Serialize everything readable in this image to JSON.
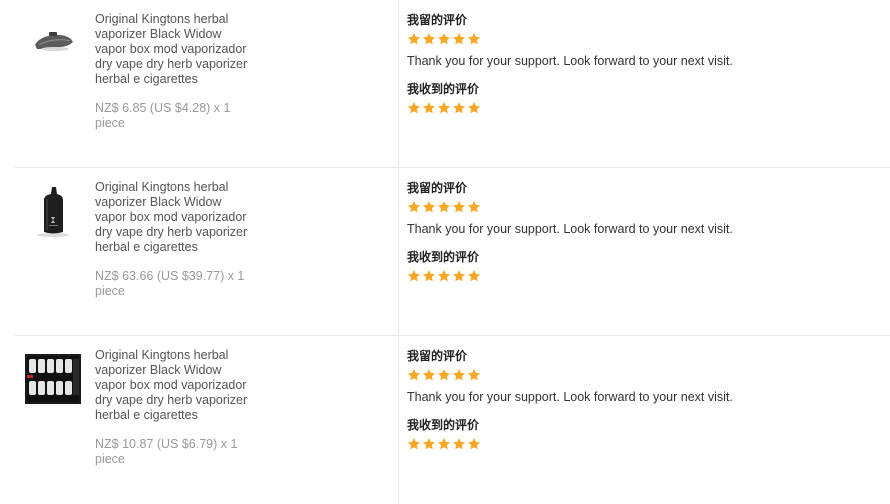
{
  "colors": {
    "star": "#f5a623",
    "divider": "#e8e8e8",
    "title_text": "#555555",
    "price_text": "#999999"
  },
  "rows": [
    {
      "product_icon": "vaporizer-mouthpiece",
      "title": "Original Kingtons herbal vaporizer Black Widow vapor box mod vaporizador dry vape dry herb vaporizer herbal e cigarettes",
      "price": "NZ$ 6.85 (US $4.28) x 1 piece",
      "my_review_label": "我留的评价",
      "my_rating": 5,
      "my_comment": "Thank you for your support. Look forward to your next visit.",
      "received_review_label": "我收到的评价",
      "received_rating": 5
    },
    {
      "product_icon": "black-vaporizer-device",
      "title": "Original Kingtons herbal vaporizer Black Widow vapor box mod vaporizador dry vape dry herb vaporizer herbal e cigarettes",
      "price": "NZ$ 63.66 (US $39.77) x 1 piece",
      "my_review_label": "我留的评价",
      "my_rating": 5,
      "my_comment": "Thank you for your support. Look forward to your next visit.",
      "received_review_label": "我收到的评价",
      "received_rating": 5
    },
    {
      "product_icon": "filter-tips-set",
      "title": "Original Kingtons herbal vaporizer Black Widow vapor box mod vaporizador dry vape dry herb vaporizer herbal e cigarettes",
      "price": "NZ$ 10.87 (US $6.79) x 1 piece",
      "my_review_label": "我留的评价",
      "my_rating": 5,
      "my_comment": "Thank you for your support. Look forward to your next visit.",
      "received_review_label": "我收到的评价",
      "received_rating": 5
    }
  ]
}
